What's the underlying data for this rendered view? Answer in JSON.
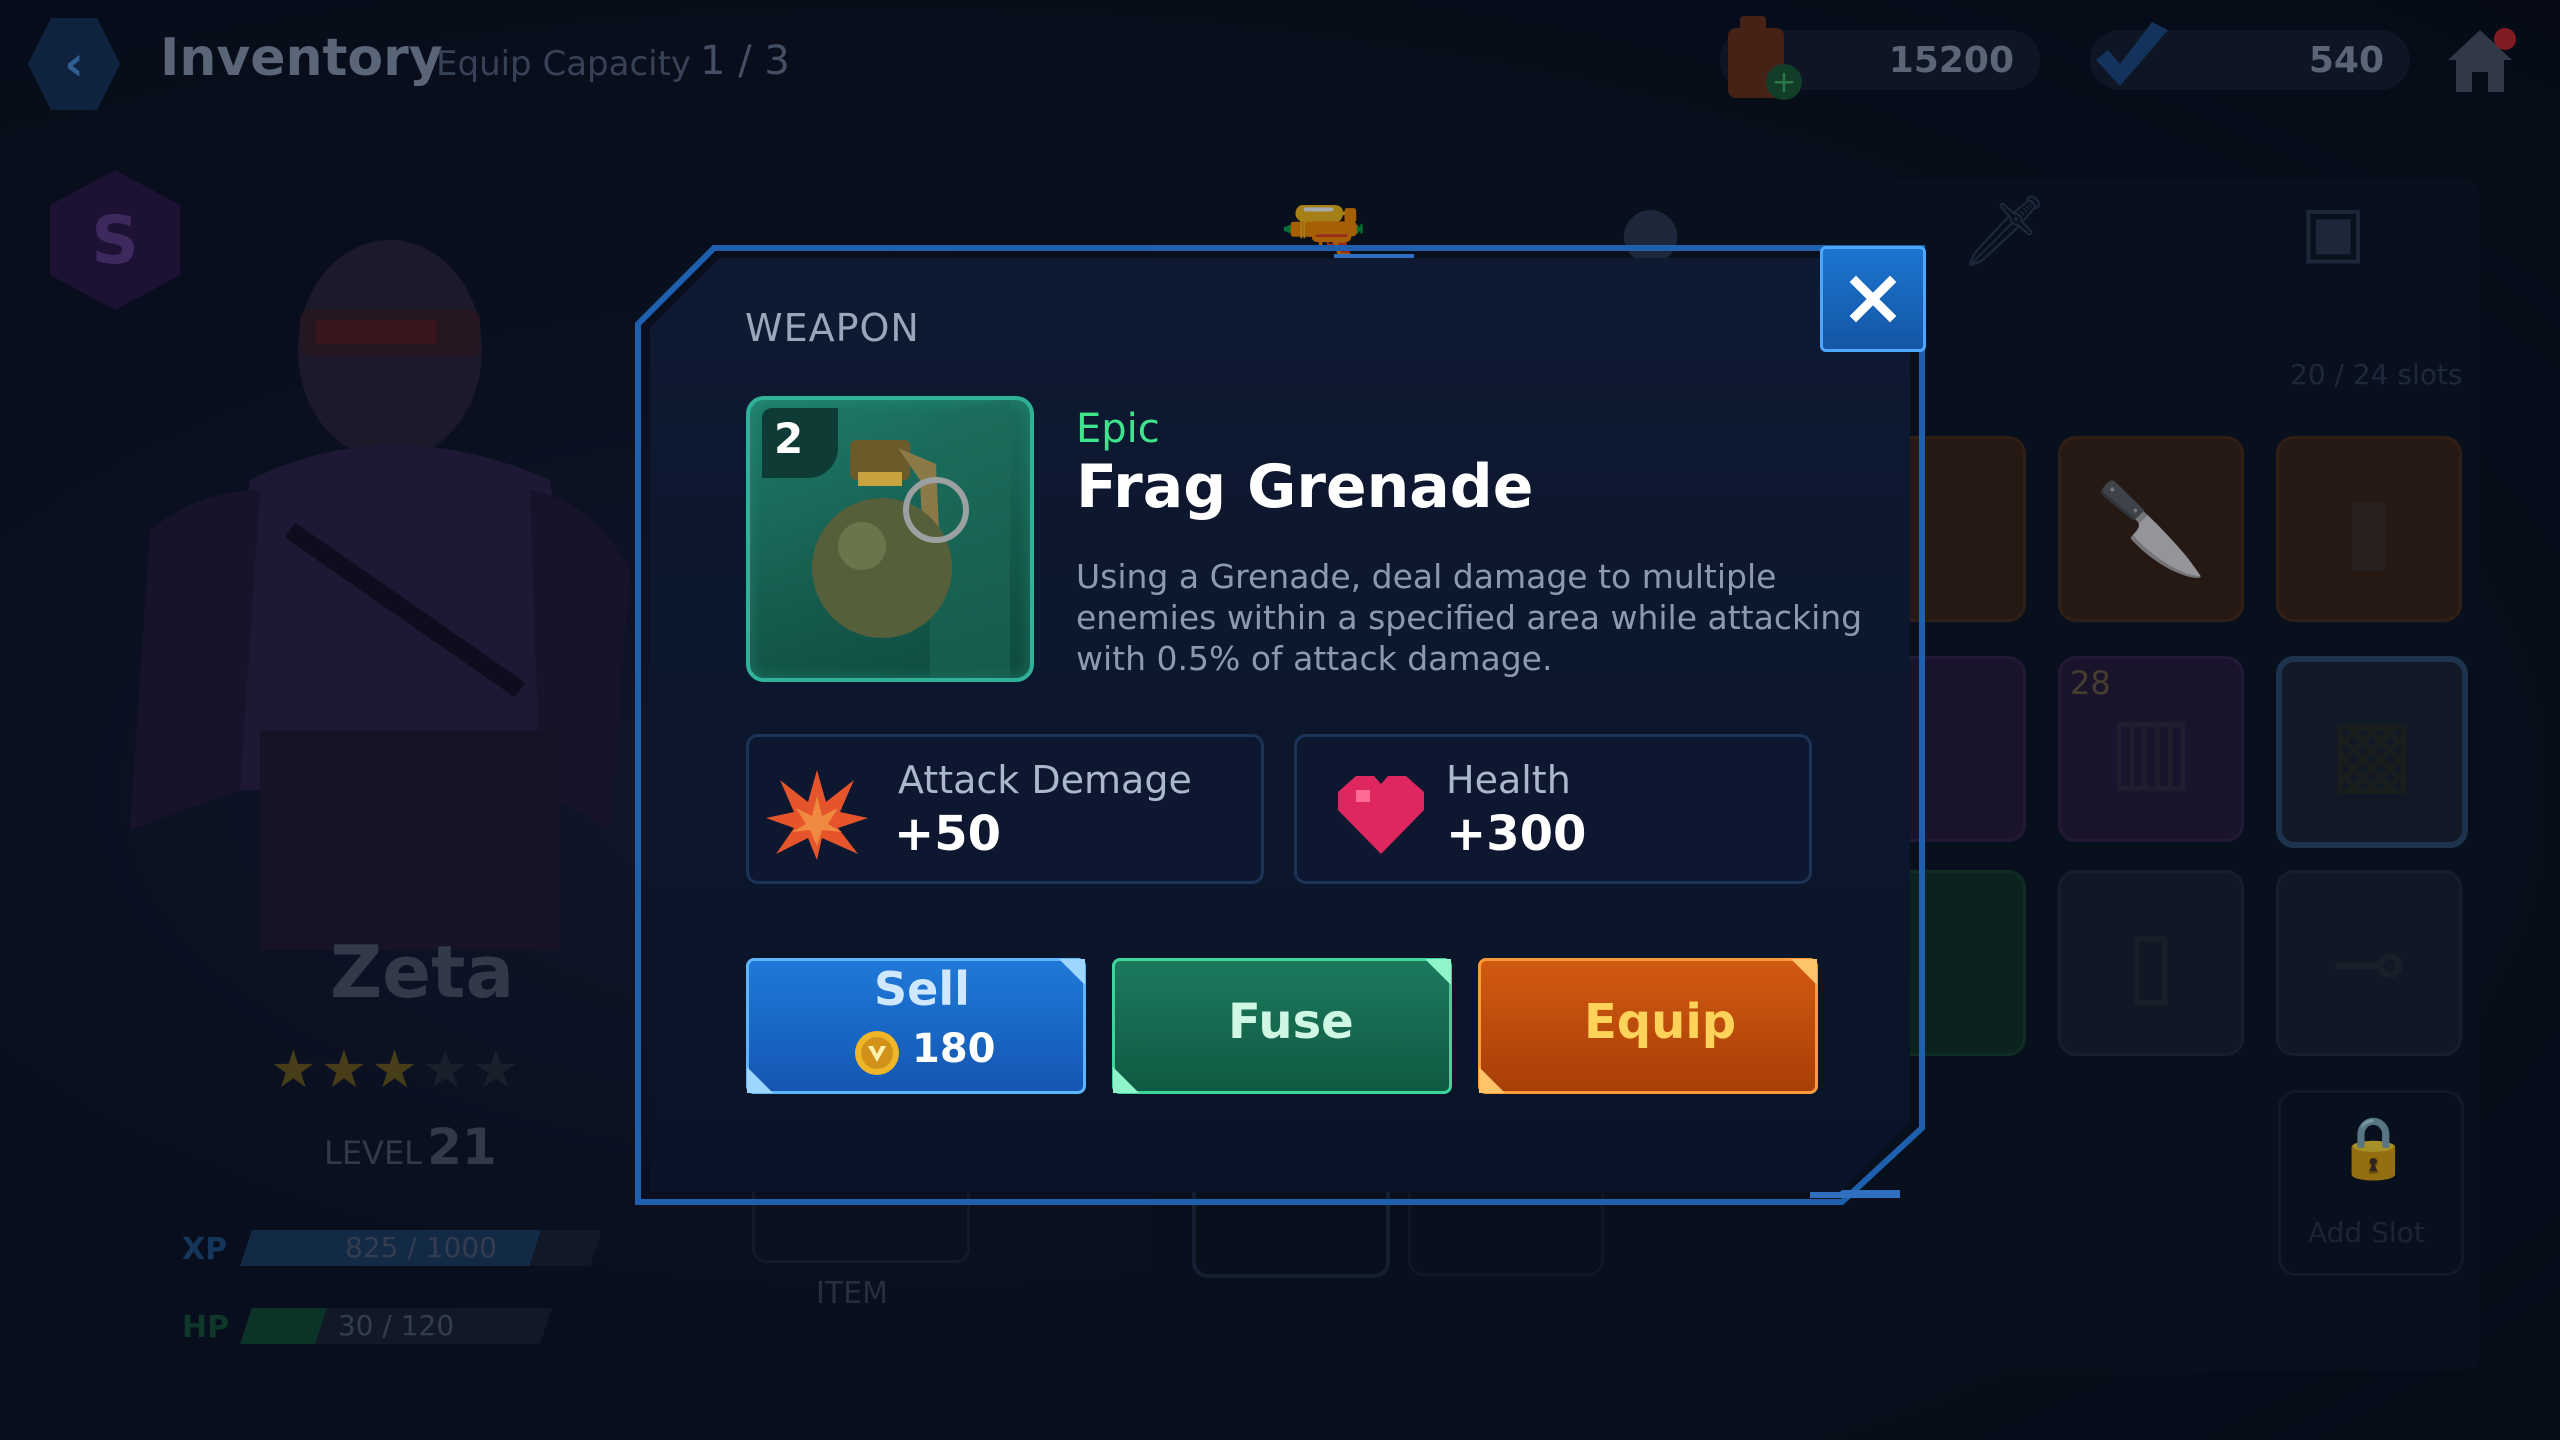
{
  "header": {
    "title": "Inventory",
    "equip_capacity_label": "Equip Capacity",
    "equip_capacity_value": "1 / 3",
    "fuel_amount": "15200",
    "gem_amount": "540"
  },
  "character": {
    "rank": "S",
    "name": "Zeta",
    "stars_filled": 3,
    "stars_total": 5,
    "level_label": "LEVEL",
    "level_value": "21",
    "xp_label": "XP",
    "xp_value": "825 / 1000",
    "xp_fraction": 0.825,
    "hp_label": "HP",
    "hp_value": "30 / 120",
    "hp_fraction": 0.25,
    "item_label": "ITEM"
  },
  "inventory": {
    "slots_text": "20 / 24 slots",
    "stack_count": "28",
    "add_slot_label": "Add Slot"
  },
  "modal": {
    "category": "WEAPON",
    "item_count": "2",
    "rarity": "Epic",
    "name": "Frag Grenade",
    "description": "Using a Grenade, deal damage to multiple enemies within a specified area while attacking with 0.5% of attack damage.",
    "stats": [
      {
        "label": "Attack Demage",
        "value": "+50",
        "icon": "explosion-icon"
      },
      {
        "label": "Health",
        "value": "+300",
        "icon": "heart-icon"
      }
    ],
    "buttons": {
      "sell_label": "Sell",
      "sell_price": "180",
      "fuse_label": "Fuse",
      "equip_label": "Equip"
    }
  },
  "colors": {
    "rarity_epic": "#3fe58c",
    "sell_blue": "#1f79d8",
    "fuse_green": "#1c7a5d",
    "equip_orange": "#d25a10",
    "equip_text": "#ffd35a"
  }
}
